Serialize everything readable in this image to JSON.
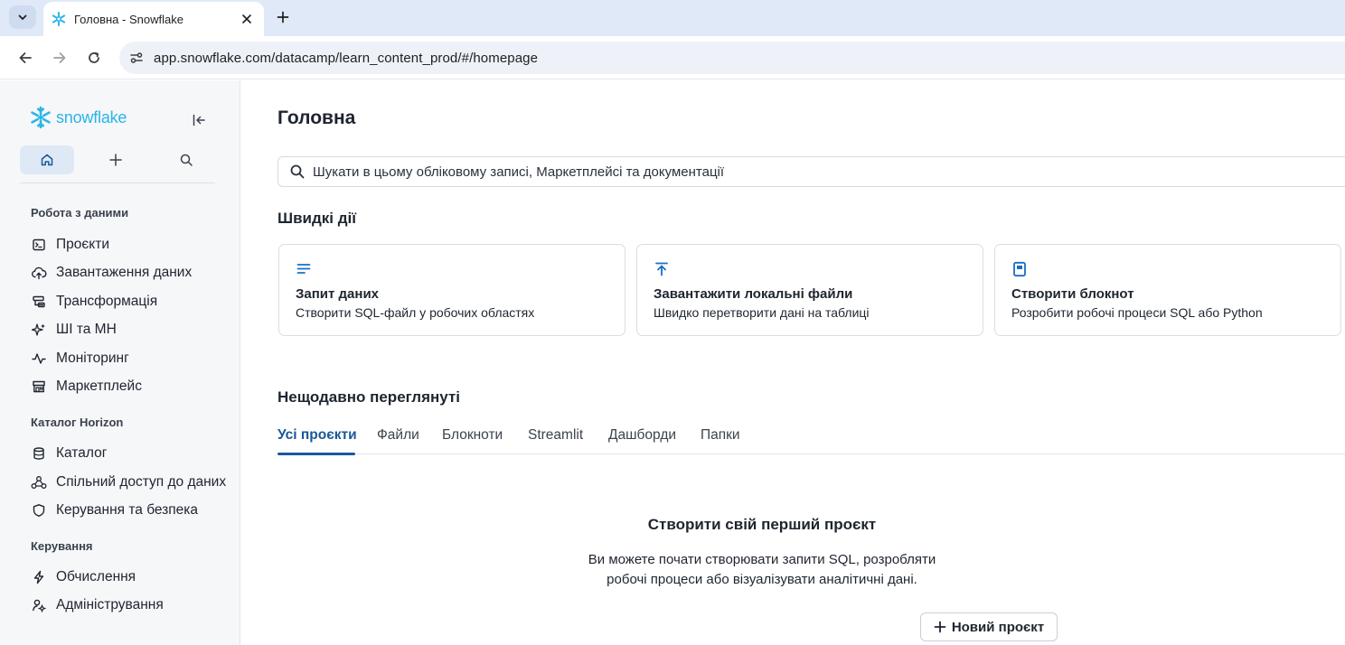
{
  "browser": {
    "tab_title": "Головна - Snowflake",
    "url": "app.snowflake.com/datacamp/learn_content_prod/#/homepage"
  },
  "sidebar": {
    "logo_text": "snowflake",
    "sections": [
      {
        "title": "Робота з даними",
        "items": [
          {
            "label": "Проєкти",
            "icon": "terminal-icon"
          },
          {
            "label": "Завантаження даних",
            "icon": "cloud-upload-icon"
          },
          {
            "label": "Трансформація",
            "icon": "transform-icon"
          },
          {
            "label": "ШІ та МН",
            "icon": "sparkle-icon"
          },
          {
            "label": "Моніторинг",
            "icon": "activity-icon"
          },
          {
            "label": "Маркетплейс",
            "icon": "store-icon"
          }
        ]
      },
      {
        "title": "Каталог Horizon",
        "items": [
          {
            "label": "Каталог",
            "icon": "database-icon"
          },
          {
            "label": "Спільний доступ до даних",
            "icon": "share-icon"
          },
          {
            "label": "Керування та безпека",
            "icon": "shield-icon"
          }
        ]
      },
      {
        "title": "Керування",
        "items": [
          {
            "label": "Обчислення",
            "icon": "bolt-icon"
          },
          {
            "label": "Адміністрування",
            "icon": "admin-icon"
          }
        ]
      }
    ]
  },
  "main": {
    "title": "Головна",
    "search_placeholder": "Шукати в цьому обліковому записі, Маркетплейсі та документації",
    "quick_actions_title": "Швидкі дії",
    "quick_actions": [
      {
        "title": "Запит даних",
        "desc": "Створити SQL-файл у робочих областях",
        "icon": "list-icon"
      },
      {
        "title": "Завантажити локальні файли",
        "desc": "Швидко перетворити дані на таблиці",
        "icon": "upload-icon"
      },
      {
        "title": "Створити блокнот",
        "desc": "Розробити робочі процеси SQL або Python",
        "icon": "notebook-icon"
      }
    ],
    "recent_title": "Нещодавно переглянуті",
    "tabs": [
      "Усі проєкти",
      "Файли",
      "Блокноти",
      "Streamlit",
      "Дашборди",
      "Папки"
    ],
    "active_tab": "Усі проєкти",
    "empty_title": "Створити свій перший проєкт",
    "empty_desc_line1": "Ви можете почати створювати запити SQL, розробляти",
    "empty_desc_line2": "робочі процеси або візуалізувати аналітичні дані.",
    "new_project_label": "Новий проєкт"
  },
  "colors": {
    "brand": "#29b5e8",
    "accent": "#1a5799",
    "icon_blue": "#1a6fc4"
  }
}
